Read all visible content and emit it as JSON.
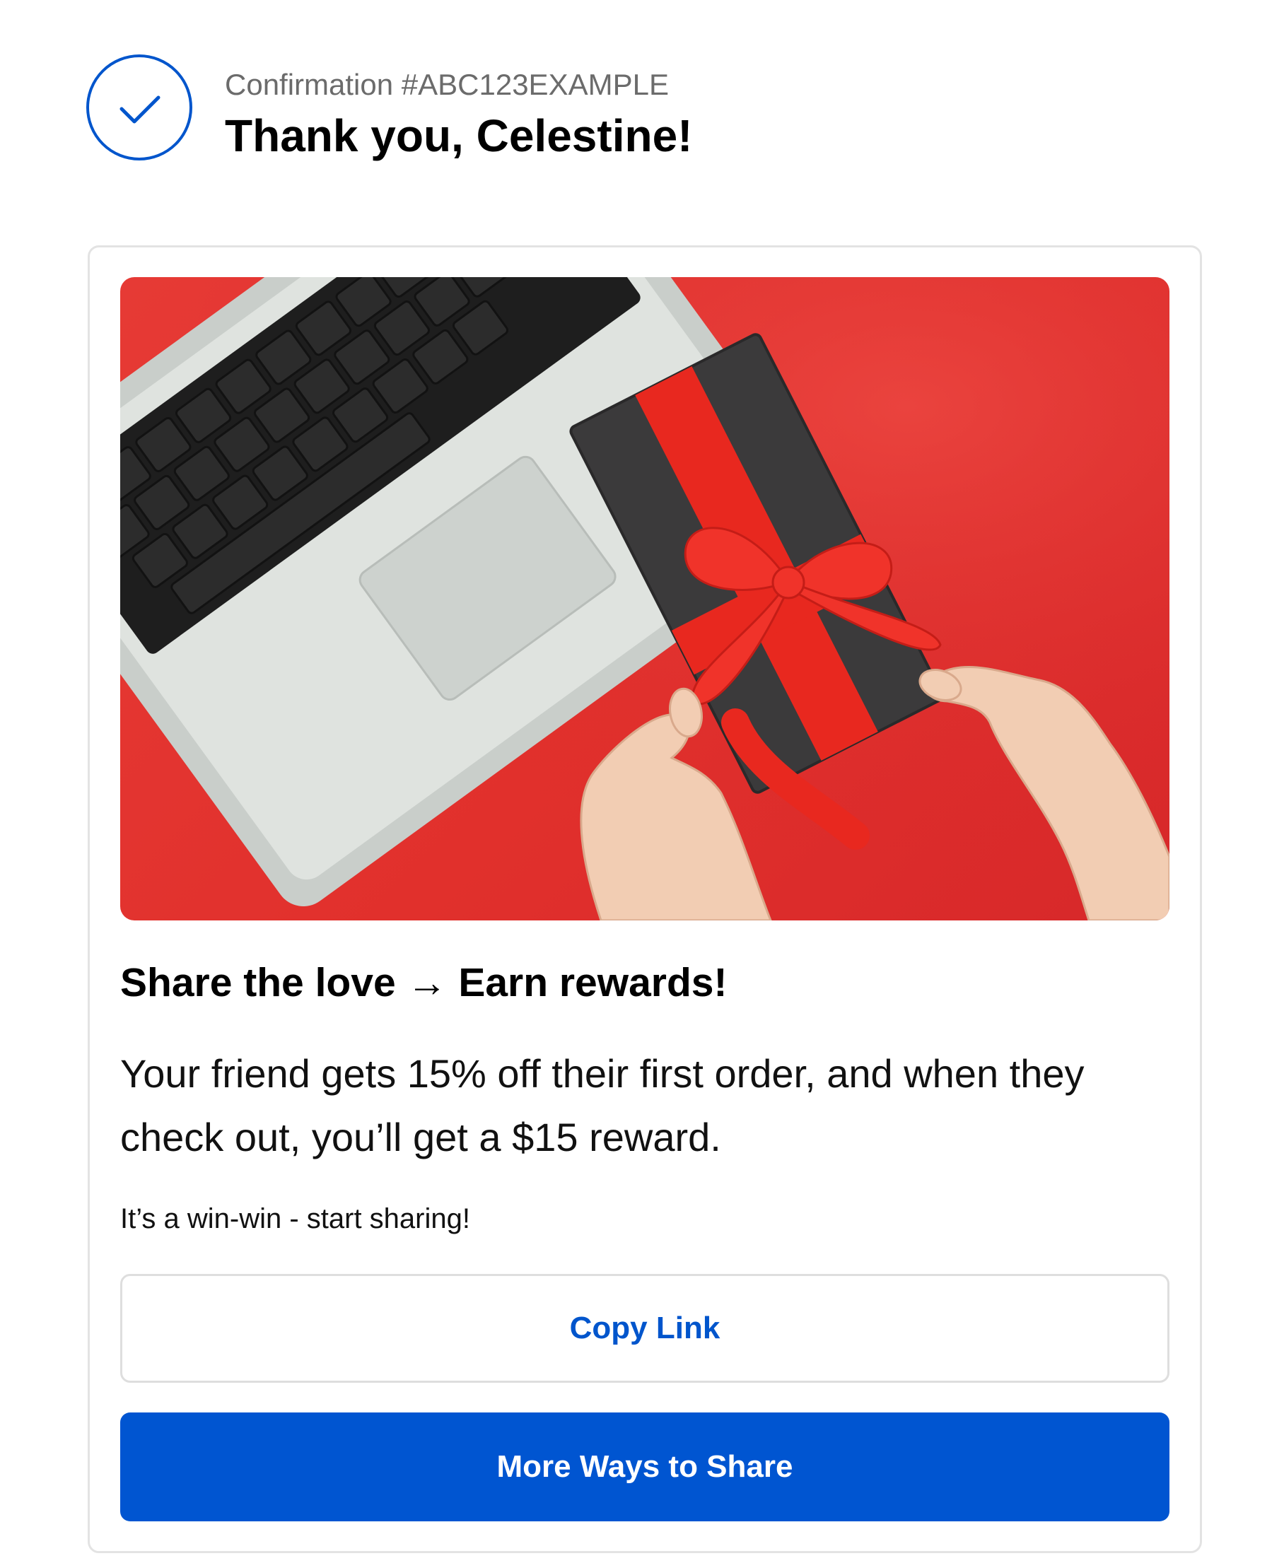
{
  "header": {
    "confirmation": "Confirmation #ABC123EXAMPLE",
    "greeting": "Thank you, Celestine!"
  },
  "referral": {
    "image_alt": "Hands tying a red ribbon on a black gift box next to a laptop on a red background",
    "title": "Share the love → Earn rewards!",
    "body": "Your friend gets 15% off their first order, and when they check out, you’ll get a $15 reward.",
    "tagline": "It’s a win-win - start sharing!",
    "copy_link_label": "Copy Link",
    "more_ways_label": "More Ways to Share"
  },
  "colors": {
    "accent": "#0055cc",
    "primary_button": "#0055d1",
    "hero_background": "#e1302c"
  },
  "icons": {
    "header_icon": "check-circle-icon"
  }
}
